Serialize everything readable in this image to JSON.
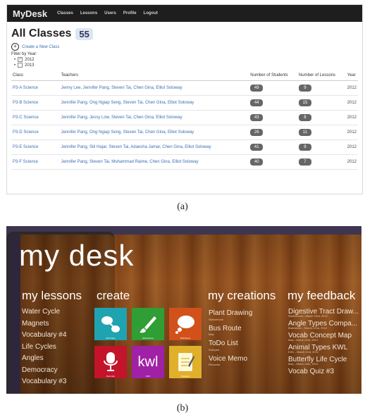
{
  "panel_a": {
    "brand": "MyDesk",
    "nav": [
      "Classes",
      "Lessons",
      "Users",
      "Profile",
      "Logout"
    ],
    "page_title": "All Classes",
    "class_count": "55",
    "create_link": "Create a New Class",
    "filter_label": "Filter by Year:",
    "years": [
      {
        "label": "2012",
        "checked": true
      },
      {
        "label": "2013",
        "checked": false
      }
    ],
    "columns": {
      "class": "Class",
      "teachers": "Teachers",
      "students": "Number of Students",
      "lessons": "Number of Lessons",
      "year": "Year"
    },
    "rows": [
      {
        "class": "P3-A Science",
        "teachers": "Jenny Lee, Jennifer Pang, Steven Tai, Chen Gina, Elliot Soloway",
        "students": "49",
        "lessons": "9",
        "year": "2012"
      },
      {
        "class": "P3-B Science",
        "teachers": "Jennifer Pang, Ong Ngiap Seng, Steven Tai, Chen Gina, Elliot Soloway",
        "students": "44",
        "lessons": "15",
        "year": "2012"
      },
      {
        "class": "P3-C Science",
        "teachers": "Jennifer Pang, Jessy Low, Steven Tai, Chen Gina, Elliot Soloway",
        "students": "43",
        "lessons": "8",
        "year": "2012"
      },
      {
        "class": "P3-D Science",
        "teachers": "Jennifer Pang, Ong Ngiap Seng, Steven Tai, Chen Gina, Elliot Soloway",
        "students": "26",
        "lessons": "11",
        "year": "2012"
      },
      {
        "class": "P3-E Science",
        "teachers": "Jennifer Pang, Siti Hajar, Steven Tai, Adaesha Jamar, Chen Gina, Elliot Soloway",
        "students": "41",
        "lessons": "9",
        "year": "2012"
      },
      {
        "class": "P3-F Science",
        "teachers": "Jennifer Pang, Steven Tai, Muhammad Raime, Chen Gina, Elliot Soloway",
        "students": "40",
        "lessons": "7",
        "year": "2012"
      }
    ],
    "caption": "(a)"
  },
  "panel_b": {
    "title": "my desk",
    "lessons_title": "my lessons",
    "lessons": [
      "Water Cycle",
      "Magnets",
      "Vocabulary #4",
      "Life Cycles",
      "Angles",
      "Democracy",
      "Vocabulary #3"
    ],
    "create_title": "create",
    "tiles": [
      {
        "label": "Mind Map",
        "icon": "mindmap-icon",
        "color": "#1fa3b0"
      },
      {
        "label": "Sketchbook",
        "icon": "paintbrush-icon",
        "color": "#2f9e34"
      },
      {
        "label": "Brainstorm",
        "icon": "thought-bubble-icon",
        "color": "#d2511a"
      },
      {
        "label": "Recorder",
        "icon": "microphone-icon",
        "color": "#c3142c"
      },
      {
        "label": "KWL",
        "icon": "kwl-icon",
        "text": "kwl",
        "color": "#a021a6"
      },
      {
        "label": "Notepad",
        "icon": "notepad-icon",
        "color": "#e0b02a"
      }
    ],
    "creations_title": "my creations",
    "creations": [
      {
        "name": "Plant Drawing",
        "type": "Sketchbook"
      },
      {
        "name": "Bus Route",
        "type": "Map"
      },
      {
        "name": "ToDo List",
        "type": "Notepad"
      },
      {
        "name": "Voice Memo",
        "type": "Recorder"
      }
    ],
    "feedback_title": "my feedback",
    "feedback": [
      {
        "name": "Digestive Tract Draw...",
        "meta": "Sketchbook - March 23rd, 2012"
      },
      {
        "name": "Angle Types Compa...",
        "meta": "Brainstorm - March 22nd, 2012"
      },
      {
        "name": "Vocab Concept Map",
        "meta": "Map - March 21st, 2012"
      },
      {
        "name": "Animal Types KWL",
        "meta": "KWL - March 21st, 2012"
      },
      {
        "name": "Butterfly Life Cycle",
        "meta": "Map - March 20th, 2012"
      },
      {
        "name": "Vocab Quiz #3",
        "meta": ""
      }
    ],
    "caption": "(b)"
  }
}
